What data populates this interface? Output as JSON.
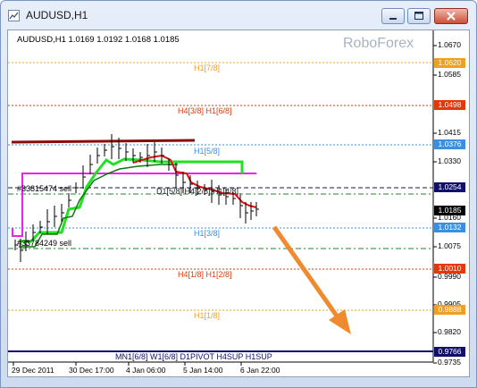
{
  "window": {
    "title": "AUDUSD,H1"
  },
  "chart": {
    "symbol_info": "AUDUSD,H1  1.0169 1.0192 1.0168 1.0185",
    "watermark": "RoboForex",
    "price_ticks": [
      "1.0670",
      "1.0585",
      "1.0415",
      "1.0330",
      "1.0160",
      "1.0075",
      "0.9990",
      "0.9905",
      "0.9820",
      "0.9735"
    ],
    "time_ticks": [
      "29 Dec 2011",
      "30 Dec 17:00",
      "4 Jan 06:00",
      "5 Jan 14:00",
      "6 Jan 22:00"
    ],
    "level_labels": [
      {
        "text": "H1[7/8]",
        "color": "#f0a020"
      },
      {
        "text": "H4[3/8] H1[6/8]",
        "color": "#e2380b"
      },
      {
        "text": "H1[5/8]",
        "color": "#3a8fe0"
      },
      {
        "text": "D1[5/8] H4[2/8] H1[4/8]",
        "color": "#222222"
      },
      {
        "text": "H1[3/8]",
        "color": "#3a8fe0"
      },
      {
        "text": "H4[1/8] H1[2/8]",
        "color": "#e2380b"
      },
      {
        "text": "H1[1/8]",
        "color": "#f0a020"
      },
      {
        "text": "MN1[6/8] W1[6/8] D1PIVOT H4SUP H1SUP",
        "color": "#10106a"
      }
    ],
    "price_tags": [
      {
        "text": "1.0620",
        "color": "#f0a020"
      },
      {
        "text": "1.0498",
        "color": "#e2380b"
      },
      {
        "text": "1.0376",
        "color": "#3a8fe0"
      },
      {
        "text": "1.0254",
        "color": "#10106a"
      },
      {
        "text": "1.0185",
        "color": "#000000"
      },
      {
        "text": "1.0132",
        "color": "#3a8fe0"
      },
      {
        "text": "1.0010",
        "color": "#e2380b"
      },
      {
        "text": "0.9888",
        "color": "#f0a020"
      },
      {
        "text": "0.9766",
        "color": "#10106a"
      }
    ],
    "orders": {
      "sell_1": "#33815474 sell",
      "sell_2": "#33784249 sell"
    }
  }
}
